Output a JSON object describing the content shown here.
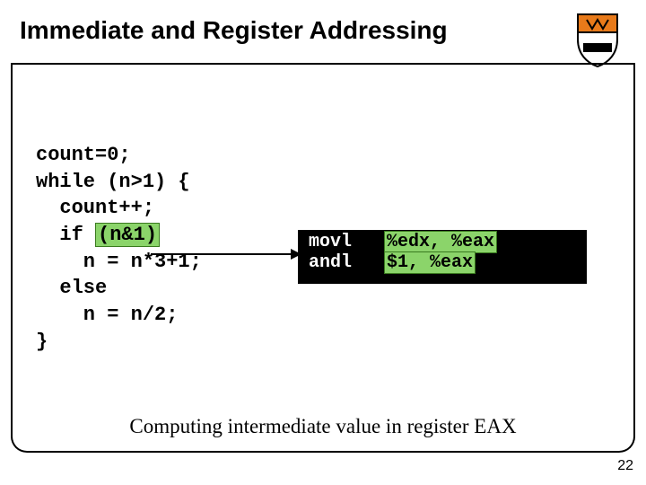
{
  "title": "Immediate and Register Addressing",
  "c_code": {
    "l1": "count=0;",
    "l2": "while (n>1) {",
    "l3": "  count++;",
    "l4a": "  if ",
    "l4_hl": "(n&1)",
    "l5": "    n = n*3+1;",
    "l6": "  else",
    "l7": "    n = n/2;",
    "l8": "}"
  },
  "asm": {
    "r1_op": "movl",
    "r1_args": "%edx, %eax",
    "r2_op": "andl",
    "r2_args": "$1, %eax"
  },
  "caption": "Computing intermediate value in register EAX",
  "page_number": "22",
  "colors": {
    "highlight": "#8bd46a",
    "asm_bg": "#000000"
  }
}
